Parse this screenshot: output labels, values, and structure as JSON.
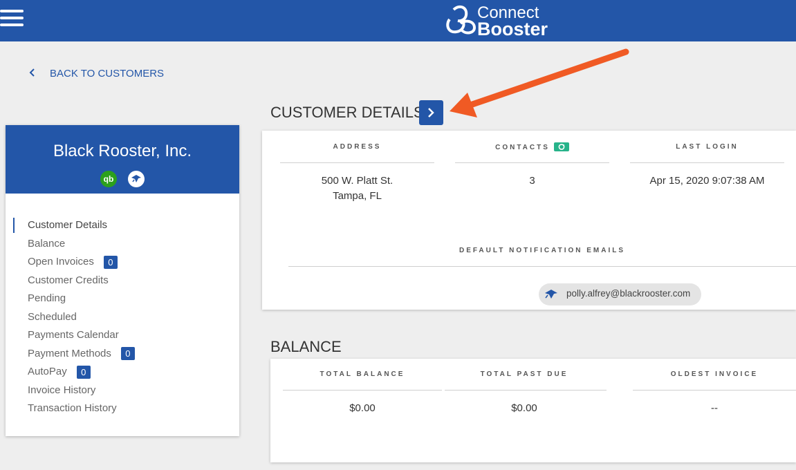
{
  "header": {
    "logo_line1": "Connect",
    "logo_line2": "Booster",
    "bg_color": "#2356a8"
  },
  "nav": {
    "back_label": "BACK TO CUSTOMERS"
  },
  "customer": {
    "name": "Black Rooster, Inc.",
    "qb_icon_text": "qb"
  },
  "menu": {
    "items": [
      {
        "label": "Customer Details",
        "active": true
      },
      {
        "label": "Balance"
      },
      {
        "label": "Open Invoices",
        "badge": "0"
      },
      {
        "label": "Customer Credits"
      },
      {
        "label": "Pending"
      },
      {
        "label": "Scheduled"
      },
      {
        "label": "Payments Calendar"
      },
      {
        "label": "Payment Methods",
        "badge": "0"
      },
      {
        "label": "AutoPay",
        "badge": "0"
      },
      {
        "label": "Invoice History"
      },
      {
        "label": "Transaction History"
      }
    ]
  },
  "details": {
    "title": "CUSTOMER DETAILS",
    "address_head": "ADDRESS",
    "address_line1": "500 W. Platt St.",
    "address_line2": "Tampa, FL",
    "contacts_head": "CONTACTS",
    "contacts_value": "3",
    "last_login_head": "LAST LOGIN",
    "last_login_value": "Apr 15, 2020 9:07:38 AM",
    "notif_head": "DEFAULT NOTIFICATION EMAILS",
    "email": "polly.alfrey@blackrooster.com"
  },
  "balance": {
    "title": "BALANCE",
    "total_balance_head": "TOTAL BALANCE",
    "total_balance_value": "$0.00",
    "past_due_head": "TOTAL PAST DUE",
    "past_due_value": "$0.00",
    "oldest_head": "OLDEST INVOICE",
    "oldest_value": "--"
  },
  "colors": {
    "accent": "#2356a8",
    "sync_green": "#27b38a",
    "qb_green": "#2ca01c",
    "annotation_arrow": "#f05a24"
  }
}
